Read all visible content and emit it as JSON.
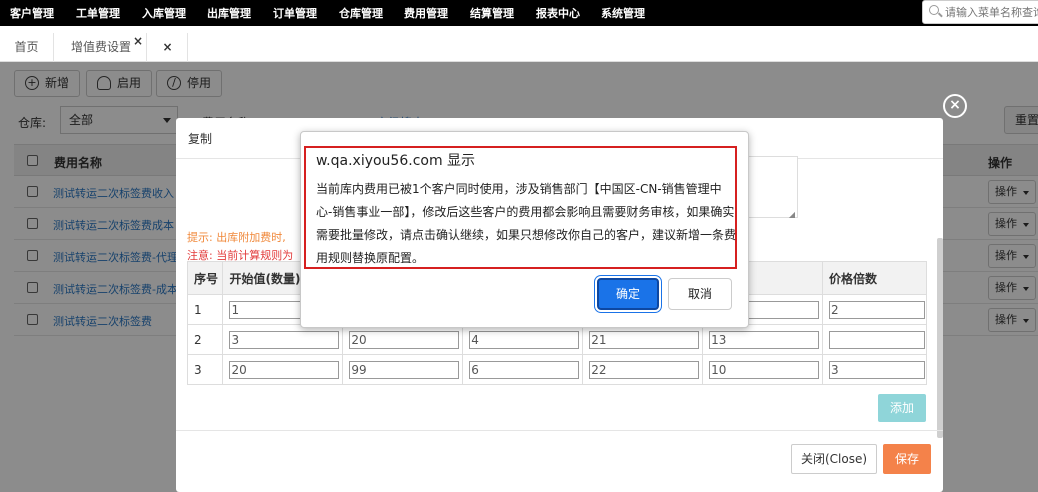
{
  "nav": {
    "items": [
      "客户管理",
      "工单管理",
      "入库管理",
      "出库管理",
      "订单管理",
      "仓库管理",
      "费用管理",
      "结算管理",
      "报表中心",
      "系统管理"
    ],
    "search_placeholder": "请输入菜单名称查询"
  },
  "tabs": {
    "home": "首页",
    "fee": "增值费设置",
    "fee_close": "×",
    "close_all": "×"
  },
  "toolbar": {
    "add": "新增",
    "enable": "启用",
    "disable": "停用",
    "reset": "重置"
  },
  "filter": {
    "warehouse_label": "仓库:",
    "warehouse_value": "全部",
    "fee_name_label": "费用名称",
    "advanced": "高级搜索"
  },
  "grid": {
    "col_name": "费用名称",
    "col_op": "操作",
    "rows": [
      "测试转运二次标签费收入",
      "测试转运二次标签费成本",
      "测试转运二次标签费-代理",
      "测试转运二次标签费-成本",
      "测试转运二次标签费"
    ],
    "op_label": "操作"
  },
  "modal": {
    "title": "复制",
    "close_icon": "×",
    "hint1": "提示:  出库附加费时,",
    "hint2": "注意:  当前计算规则为",
    "table": {
      "headers": [
        "序号",
        "开始值(数量)",
        "",
        "",
        "",
        "费",
        "价格倍数"
      ],
      "rows": [
        {
          "no": "1",
          "vals": [
            "1",
            "",
            "",
            "",
            "",
            "2"
          ]
        },
        {
          "no": "2",
          "vals": [
            "3",
            "20",
            "4",
            "21",
            "13",
            ""
          ]
        },
        {
          "no": "3",
          "vals": [
            "20",
            "99",
            "6",
            "22",
            "10",
            "3"
          ]
        }
      ]
    },
    "add": "添加",
    "close": "关闭(Close)",
    "save": "保存"
  },
  "confirm": {
    "title": "w.qa.xiyou56.com 显示",
    "message": "当前库内费用已被1个客户同时使用，涉及销售部门【中国区-CN-销售管理中心-销售事业一部】，修改后这些客户的费用都会影响且需要财务审核，如果确实需要批量修改，请点击确认继续，如果只想修改你自己的客户，建议新增一条费用规则替换原配置。",
    "ok": "确定",
    "cancel": "取消"
  }
}
